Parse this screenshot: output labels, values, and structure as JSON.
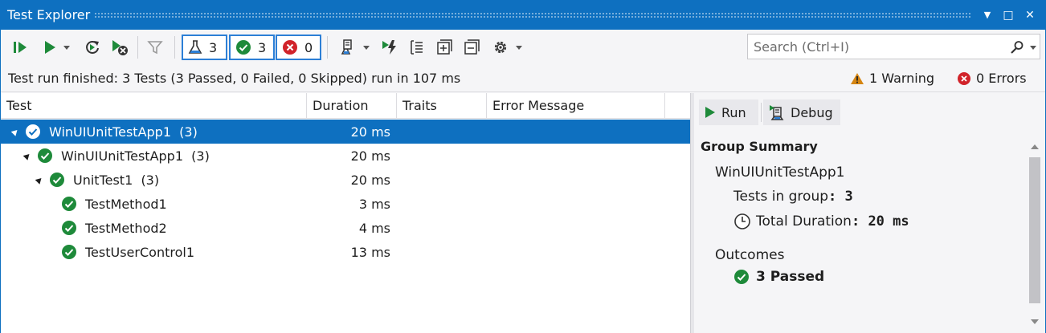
{
  "window": {
    "title": "Test Explorer",
    "controls": [
      "▼",
      "□",
      "✕"
    ]
  },
  "toolbar": {
    "total_count": "3",
    "passed_count": "3",
    "failed_count": "0"
  },
  "search": {
    "placeholder": "Search (Ctrl+I)"
  },
  "status": {
    "message": "Test run finished: 3 Tests (3 Passed, 0 Failed, 0 Skipped) run in 107 ms",
    "warnings": "1 Warning",
    "errors": "0 Errors"
  },
  "columns": [
    "Test",
    "Duration",
    "Traits",
    "Error Message"
  ],
  "rows": [
    {
      "label": "WinUIUnitTestApp1",
      "count": "(3)",
      "duration": "20 ms"
    },
    {
      "label": "WinUIUnitTestApp1",
      "count": "(3)",
      "duration": "20 ms"
    },
    {
      "label": "UnitTest1",
      "count": "(3)",
      "duration": "20 ms"
    },
    {
      "label": "TestMethod1",
      "count": "",
      "duration": "3 ms"
    },
    {
      "label": "TestMethod2",
      "count": "",
      "duration": "4 ms"
    },
    {
      "label": "TestUserControl1",
      "count": "",
      "duration": "13 ms"
    }
  ],
  "details": {
    "run_label": "Run",
    "debug_label": "Debug",
    "heading": "Group Summary",
    "group_name": "WinUIUnitTestApp1",
    "tests_in_group_label": "Tests in group",
    "tests_in_group_value": "3",
    "total_duration_label": "Total Duration",
    "total_duration_value": "20 ms",
    "outcomes_label": "Outcomes",
    "passed_summary": "3 Passed"
  },
  "colors": {
    "accent": "#0e70c0",
    "passed": "#1e8a3a",
    "failed": "#d1232a",
    "warning": "#d58512"
  }
}
